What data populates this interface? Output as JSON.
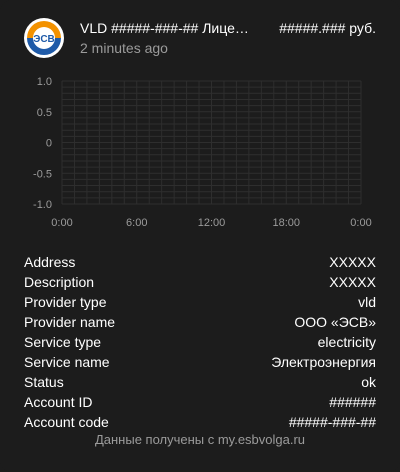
{
  "header": {
    "logo_text": "ЭСВ",
    "title": "VLD #####-###-## Лицевой счёт",
    "state": "#####.### руб.",
    "subtitle": "2 minutes ago"
  },
  "chart_data": {
    "type": "line",
    "y_ticks": [
      "1.0",
      "0.5",
      "0",
      "-0.5",
      "-1.0"
    ],
    "x_ticks": [
      "0:00",
      "6:00",
      "12:00",
      "18:00",
      "0:00"
    ],
    "ylim": [
      -1.0,
      1.0
    ],
    "grid": true,
    "series": []
  },
  "attributes": [
    {
      "key": "Address",
      "value": "XXXXX"
    },
    {
      "key": "Description",
      "value": "XXXXX"
    },
    {
      "key": "Provider type",
      "value": "vld"
    },
    {
      "key": "Provider name",
      "value": "ООО «ЭСВ»"
    },
    {
      "key": "Service type",
      "value": "electricity"
    },
    {
      "key": "Service name",
      "value": "Электроэнергия"
    },
    {
      "key": "Status",
      "value": "ok"
    },
    {
      "key": "Account ID",
      "value": "######"
    },
    {
      "key": "Account code",
      "value": "#####-###-##"
    }
  ],
  "footer": "Данные получены с my.esbvolga.ru",
  "colors": {
    "background": "#1c1c1c",
    "grid": "#2e2e2e",
    "logo_orange": "#f39200",
    "logo_blue": "#1e5aa8"
  }
}
